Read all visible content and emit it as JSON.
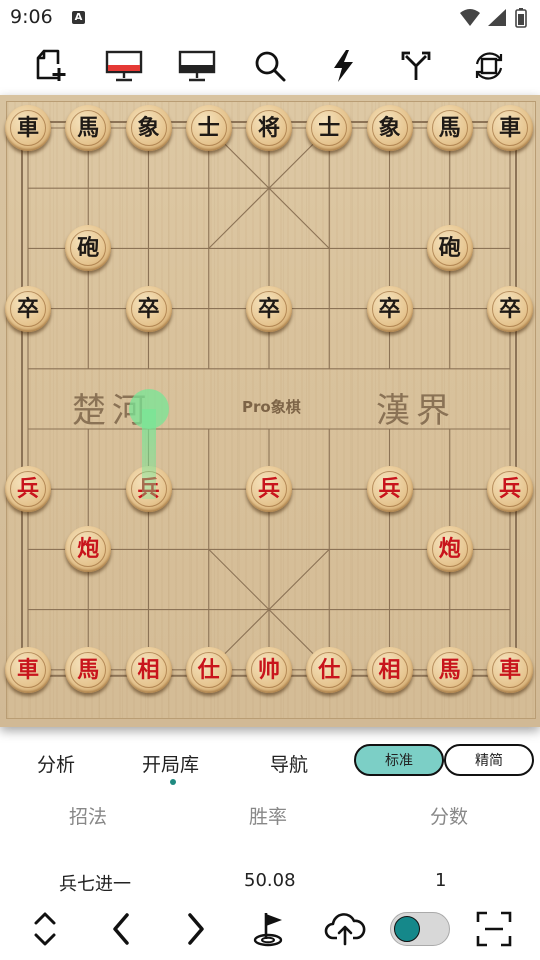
{
  "status": {
    "time": "9:06",
    "notification_glyph": "A"
  },
  "toolbar": {
    "icons": [
      "new-game-icon",
      "red-monitor-icon",
      "monitor-icon",
      "search-icon",
      "lightning-icon",
      "branch-icon",
      "flip-board-icon"
    ]
  },
  "board": {
    "river_left": "楚河",
    "river_right": "漢界",
    "brand": "Pro象棋",
    "pieces": [
      {
        "side": "black",
        "char": "車",
        "file": 0,
        "rank": 0
      },
      {
        "side": "black",
        "char": "馬",
        "file": 1,
        "rank": 0
      },
      {
        "side": "black",
        "char": "象",
        "file": 2,
        "rank": 0
      },
      {
        "side": "black",
        "char": "士",
        "file": 3,
        "rank": 0
      },
      {
        "side": "black",
        "char": "将",
        "file": 4,
        "rank": 0
      },
      {
        "side": "black",
        "char": "士",
        "file": 5,
        "rank": 0
      },
      {
        "side": "black",
        "char": "象",
        "file": 6,
        "rank": 0
      },
      {
        "side": "black",
        "char": "馬",
        "file": 7,
        "rank": 0
      },
      {
        "side": "black",
        "char": "車",
        "file": 8,
        "rank": 0
      },
      {
        "side": "black",
        "char": "砲",
        "file": 1,
        "rank": 2
      },
      {
        "side": "black",
        "char": "砲",
        "file": 7,
        "rank": 2
      },
      {
        "side": "black",
        "char": "卒",
        "file": 0,
        "rank": 3
      },
      {
        "side": "black",
        "char": "卒",
        "file": 2,
        "rank": 3
      },
      {
        "side": "black",
        "char": "卒",
        "file": 4,
        "rank": 3
      },
      {
        "side": "black",
        "char": "卒",
        "file": 6,
        "rank": 3
      },
      {
        "side": "black",
        "char": "卒",
        "file": 8,
        "rank": 3
      },
      {
        "side": "red",
        "char": "兵",
        "file": 0,
        "rank": 6
      },
      {
        "side": "red",
        "char": "兵",
        "file": 2,
        "rank": 6
      },
      {
        "side": "red",
        "char": "兵",
        "file": 4,
        "rank": 6
      },
      {
        "side": "red",
        "char": "兵",
        "file": 6,
        "rank": 6
      },
      {
        "side": "red",
        "char": "兵",
        "file": 8,
        "rank": 6
      },
      {
        "side": "red",
        "char": "炮",
        "file": 1,
        "rank": 7
      },
      {
        "side": "red",
        "char": "炮",
        "file": 7,
        "rank": 7
      },
      {
        "side": "red",
        "char": "車",
        "file": 0,
        "rank": 9
      },
      {
        "side": "red",
        "char": "馬",
        "file": 1,
        "rank": 9
      },
      {
        "side": "red",
        "char": "相",
        "file": 2,
        "rank": 9
      },
      {
        "side": "red",
        "char": "仕",
        "file": 3,
        "rank": 9
      },
      {
        "side": "red",
        "char": "帅",
        "file": 4,
        "rank": 9
      },
      {
        "side": "red",
        "char": "仕",
        "file": 5,
        "rank": 9
      },
      {
        "side": "red",
        "char": "相",
        "file": 6,
        "rank": 9
      },
      {
        "side": "red",
        "char": "馬",
        "file": 7,
        "rank": 9
      },
      {
        "side": "red",
        "char": "車",
        "file": 8,
        "rank": 9
      }
    ],
    "hint_move": {
      "from": {
        "file": 2,
        "rank": 6
      },
      "to": {
        "file": 2,
        "rank": 5
      },
      "color": "#78e696"
    }
  },
  "tabs": {
    "analysis": "分析",
    "opening_book": "开局库",
    "navigation": "导航",
    "standard": "标准",
    "simplified": "精简",
    "accent": "#7ccfc6"
  },
  "table": {
    "headers": [
      "招法",
      "胜率",
      "分数"
    ],
    "rows": [
      {
        "move": "兵七进一",
        "win_rate": "50.08",
        "score": "1"
      }
    ]
  },
  "bottombar": {
    "icons": [
      "expand-collapse-icon",
      "previous-icon",
      "next-icon",
      "flag-icon",
      "cloud-upload-icon",
      "toggle-switch",
      "scan-icon"
    ]
  }
}
